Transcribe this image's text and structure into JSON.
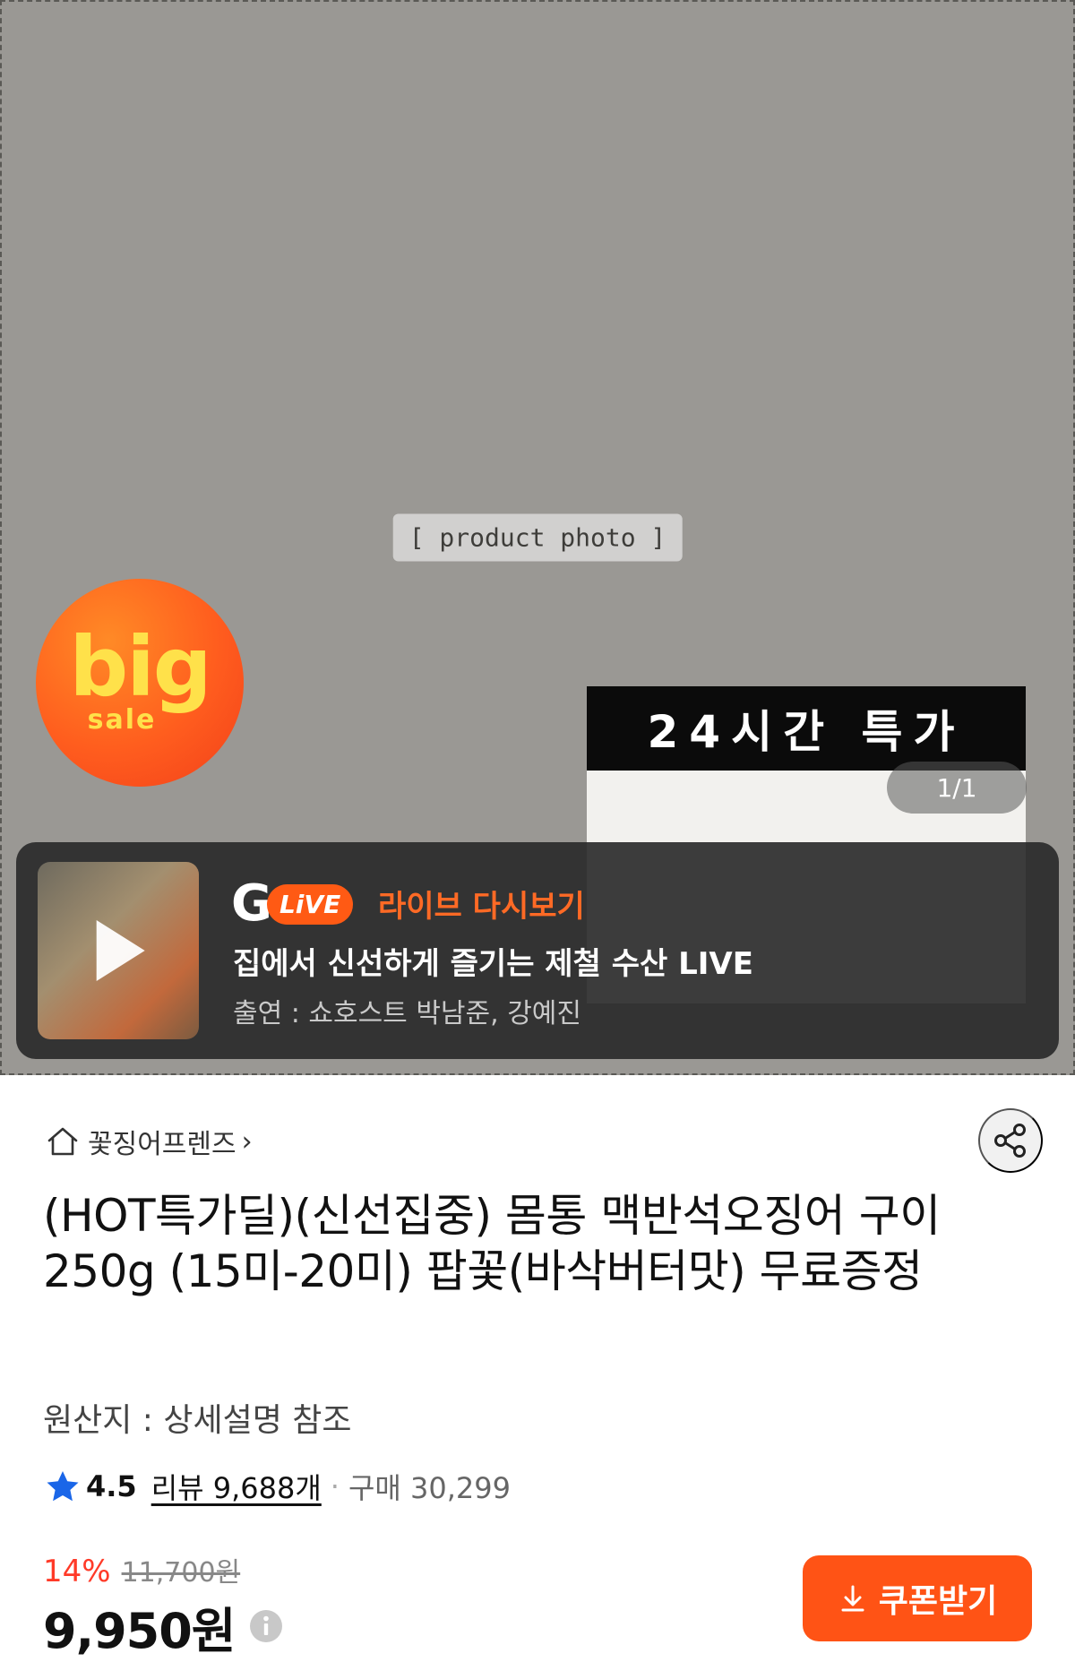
{
  "hero": {
    "photo_label": "[ product photo ]",
    "badge": {
      "big": "big",
      "sale": "sale"
    },
    "special_banner": "24시간 특가",
    "page_indicator": "1/1",
    "live": {
      "logo_g": "G",
      "logo_live": "LiVE",
      "replay": "라이브 다시보기",
      "title": "집에서 신선하게 즐기는 제철 수산 LIVE",
      "cast": "출연 : 쇼호스트 박남준, 강예진"
    }
  },
  "store": {
    "name": "꽃징어프렌즈",
    "chevron": "›"
  },
  "product": {
    "title": "(HOT특가딜)(신선집중) 몸통 맥반석오징어 구이 250g (15미-20미) 팝꽃(바삭버터맛) 무료증정",
    "origin": "원산지 : 상세설명 참조"
  },
  "rating": {
    "score": "4.5",
    "reviews": "리뷰 9,688개",
    "separator": "·",
    "purchases": "구매 30,299"
  },
  "price": {
    "discount": "14%",
    "original": "11,700원",
    "final": "9,950원"
  },
  "coupon": {
    "label": "쿠폰받기"
  },
  "colors": {
    "accent": "#ff5315",
    "discount": "#ff3a28",
    "star": "#1a66e8"
  }
}
